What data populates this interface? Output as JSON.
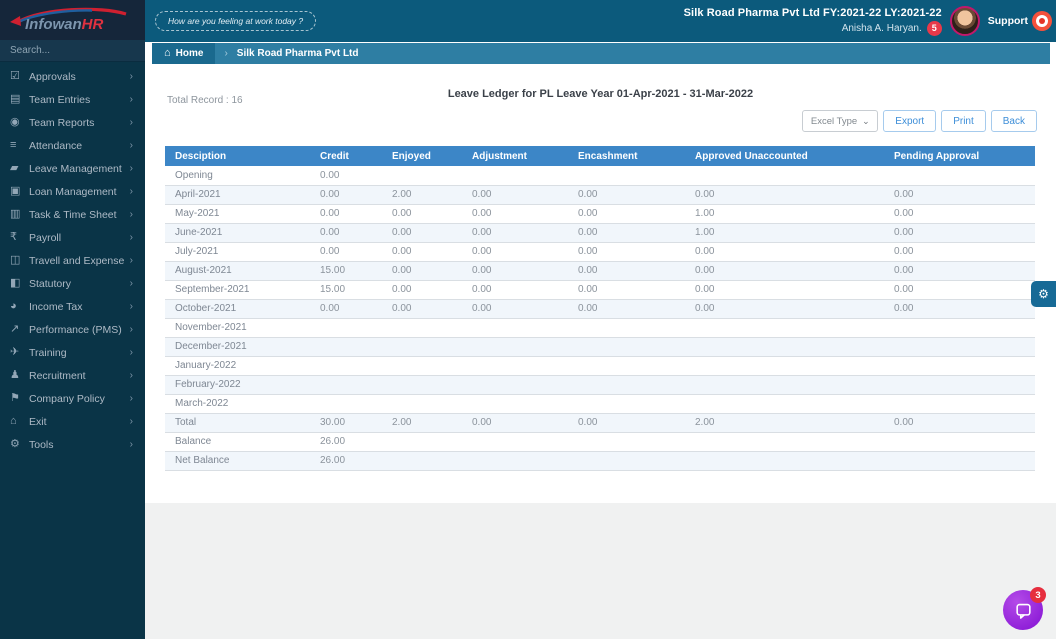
{
  "brand": {
    "name_primary": "Infowan",
    "name_accent": "HR"
  },
  "sidebar": {
    "search_placeholder": "Search...",
    "items": [
      {
        "label": "Approvals",
        "icon": "check-square-icon"
      },
      {
        "label": "Team Entries",
        "icon": "document-icon"
      },
      {
        "label": "Team Reports",
        "icon": "eye-icon"
      },
      {
        "label": "Attendance",
        "icon": "list-icon"
      },
      {
        "label": "Leave Management",
        "icon": "eraser-icon"
      },
      {
        "label": "Loan Management",
        "icon": "wallet-icon"
      },
      {
        "label": "Task & Time Sheet",
        "icon": "tasklist-icon"
      },
      {
        "label": "Payroll",
        "icon": "rupee-icon"
      },
      {
        "label": "Travell and Expense",
        "icon": "book-icon"
      },
      {
        "label": "Statutory",
        "icon": "briefcase-icon"
      },
      {
        "label": "Income Tax",
        "icon": "bomb-icon"
      },
      {
        "label": "Performance (PMS)",
        "icon": "chart-icon"
      },
      {
        "label": "Training",
        "icon": "paper-plane-icon"
      },
      {
        "label": "Recruitment",
        "icon": "person-plus-icon"
      },
      {
        "label": "Company Policy",
        "icon": "flag-icon"
      },
      {
        "label": "Exit",
        "icon": "home-icon"
      },
      {
        "label": "Tools",
        "icon": "gear-icon"
      }
    ]
  },
  "topbar": {
    "mood_button": "How are you feeling at work today ?",
    "company_line": "Silk Road Pharma Pvt Ltd FY:2021-22 LY:2021-22",
    "user_name": "Anisha A. Haryan.",
    "notification_count": "5",
    "support_label": "Support"
  },
  "breadcrumb": {
    "home": "Home",
    "current": "Silk Road Pharma Pvt Ltd"
  },
  "page": {
    "total_record": "Total Record : 16",
    "title": "Leave Ledger for PL Leave Year 01-Apr-2021 - 31-Mar-2022",
    "excel_type_label": "Excel Type",
    "export_label": "Export",
    "print_label": "Print",
    "back_label": "Back"
  },
  "table": {
    "columns": [
      "Desciption",
      "Credit",
      "Enjoyed",
      "Adjustment",
      "Encashment",
      "Approved Unaccounted",
      "Pending Approval"
    ],
    "rows": [
      [
        "Opening",
        "0.00",
        "",
        "",
        "",
        "",
        ""
      ],
      [
        "April-2021",
        "0.00",
        "2.00",
        "0.00",
        "0.00",
        "0.00",
        "0.00"
      ],
      [
        "May-2021",
        "0.00",
        "0.00",
        "0.00",
        "0.00",
        "1.00",
        "0.00"
      ],
      [
        "June-2021",
        "0.00",
        "0.00",
        "0.00",
        "0.00",
        "1.00",
        "0.00"
      ],
      [
        "July-2021",
        "0.00",
        "0.00",
        "0.00",
        "0.00",
        "0.00",
        "0.00"
      ],
      [
        "August-2021",
        "15.00",
        "0.00",
        "0.00",
        "0.00",
        "0.00",
        "0.00"
      ],
      [
        "September-2021",
        "15.00",
        "0.00",
        "0.00",
        "0.00",
        "0.00",
        "0.00"
      ],
      [
        "October-2021",
        "0.00",
        "0.00",
        "0.00",
        "0.00",
        "0.00",
        "0.00"
      ],
      [
        "November-2021",
        "",
        "",
        "",
        "",
        "",
        ""
      ],
      [
        "December-2021",
        "",
        "",
        "",
        "",
        "",
        ""
      ],
      [
        "January-2022",
        "",
        "",
        "",
        "",
        "",
        ""
      ],
      [
        "February-2022",
        "",
        "",
        "",
        "",
        "",
        ""
      ],
      [
        "March-2022",
        "",
        "",
        "",
        "",
        "",
        ""
      ],
      [
        "Total",
        "30.00",
        "2.00",
        "0.00",
        "0.00",
        "2.00",
        "0.00"
      ],
      [
        "Balance",
        "26.00",
        "",
        "",
        "",
        "",
        ""
      ],
      [
        "Net Balance",
        "26.00",
        "",
        "",
        "",
        "",
        ""
      ]
    ]
  },
  "floating": {
    "chat_badge": "3"
  },
  "colors": {
    "sidebar_bg": "#0a3447",
    "logo_strip_bg": "#15263a",
    "topbar_bg": "#0c5a7c",
    "breadcrumb_bg": "#2e7ea3",
    "breadcrumb_home_bg": "#1a698e",
    "table_header_bg": "#3c86c7",
    "row_alt_bg": "#f1f6fb",
    "accent_blue": "#3d8ed8",
    "badge_red": "#e8394a",
    "chat_purple": "#9b2fe0",
    "logo_accent_red": "#e03240",
    "settings_fab_bg": "#176a96"
  }
}
